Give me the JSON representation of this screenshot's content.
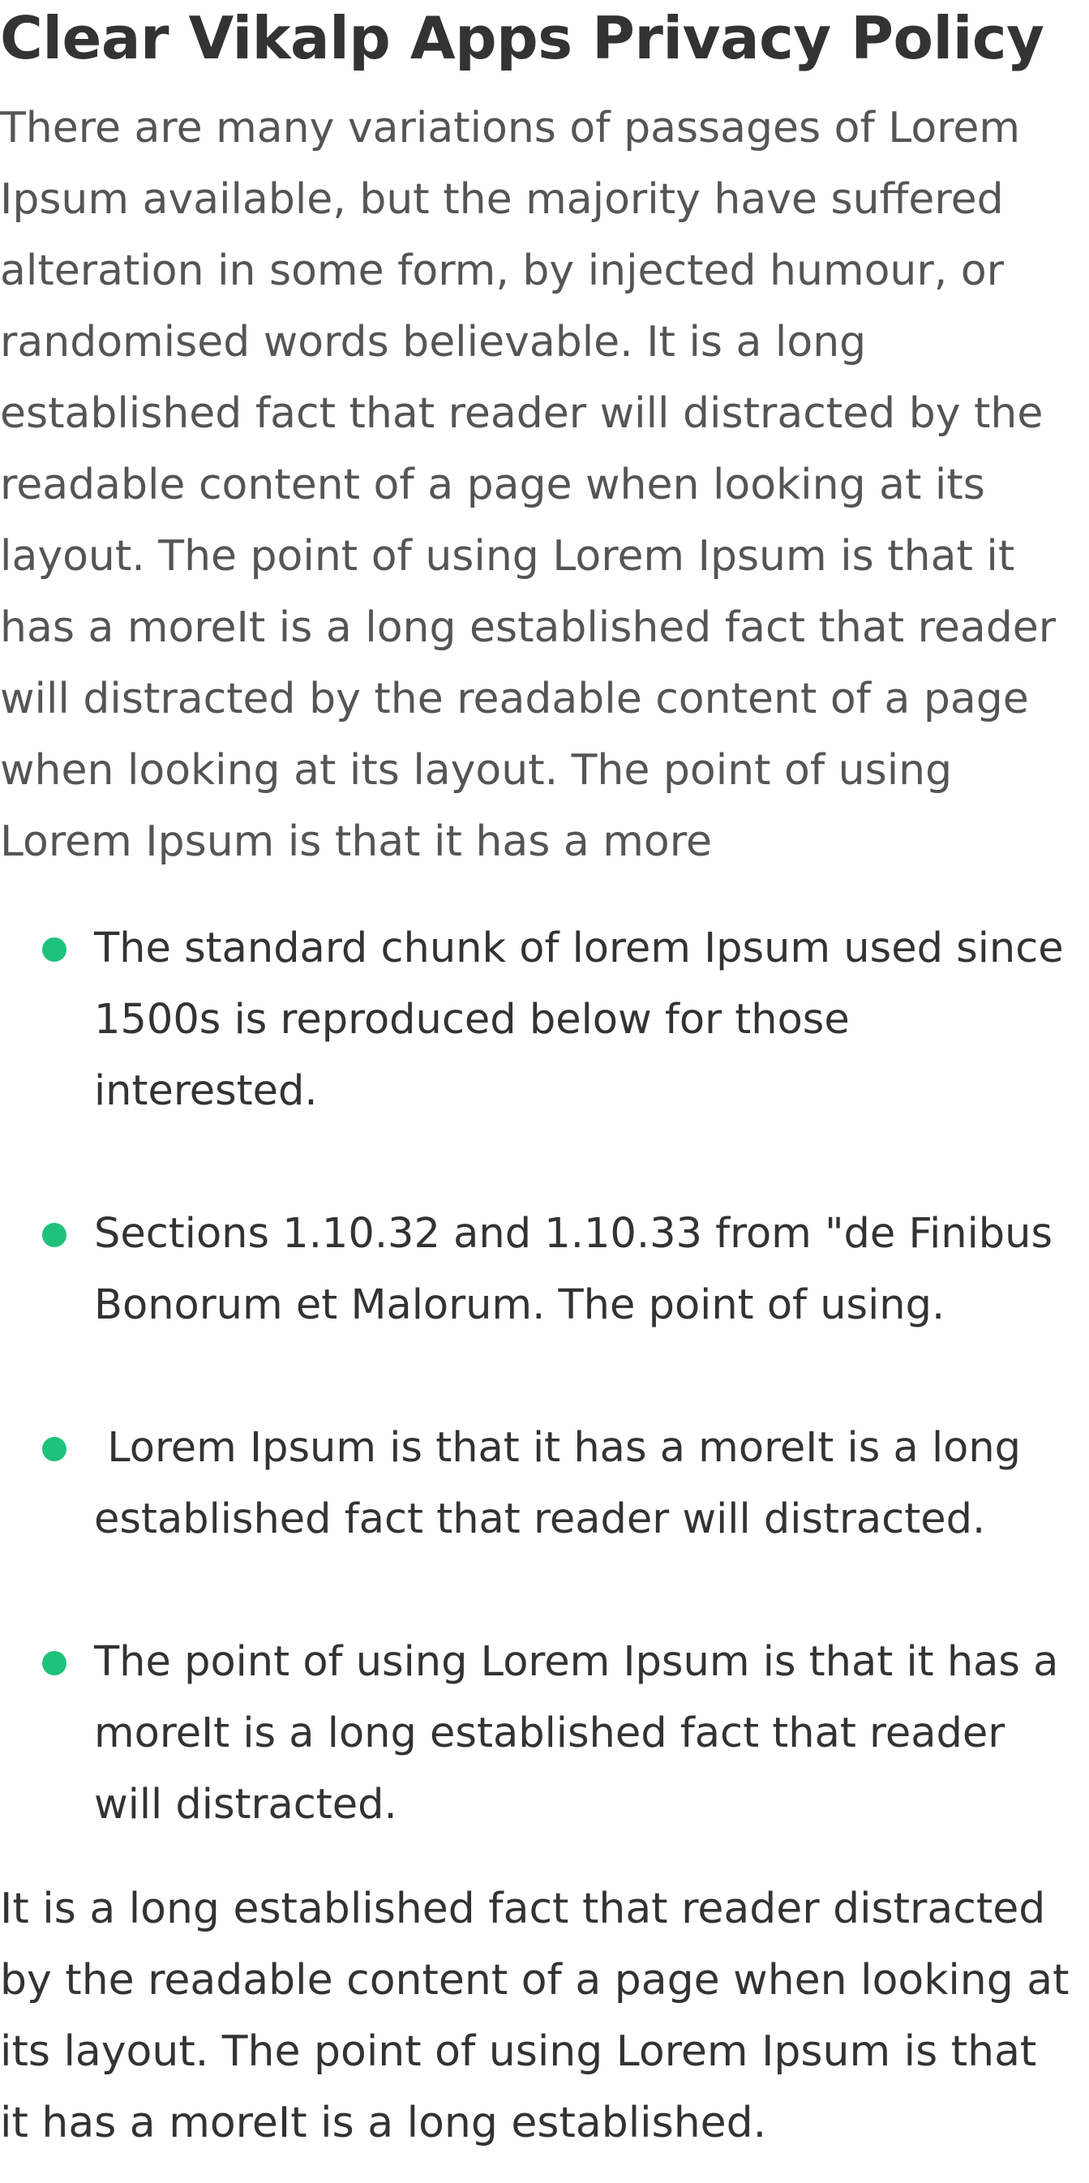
{
  "page": {
    "title": "Clear Vikalp Apps Privacy Policy",
    "intro": "There are many variations of passages of Lorem Ipsum available, but the majority have suffered alteration in some form, by injected humour, or randomised words believable. It is a long established fact that reader will distracted by the readable content of a page when looking at its layout. The point of using Lorem Ipsum is that it has a moreIt is a long established fact that reader will distracted by the readable content of a page when looking at its layout. The point of using Lorem Ipsum is that it has a more",
    "bullets": [
      "The standard chunk of lorem Ipsum used since 1500s is reproduced below for those interested.",
      "Sections 1.10.32 and 1.10.33 from \"de Finibus Bonorum et Malorum. The point of using.",
      " Lorem Ipsum is that it has a moreIt is a long established fact that reader will distracted.",
      "The point of using Lorem Ipsum is that it has a moreIt is a long established fact that reader will distracted."
    ],
    "outro": "It is a long established fact that reader distracted by the readable content of a page when looking at its layout. The point of using Lorem Ipsum is that it has a moreIt is a long established."
  },
  "colors": {
    "bullet": "#1ec27b",
    "heading": "#333333",
    "intro_text": "#555555",
    "body_text": "#333333"
  }
}
